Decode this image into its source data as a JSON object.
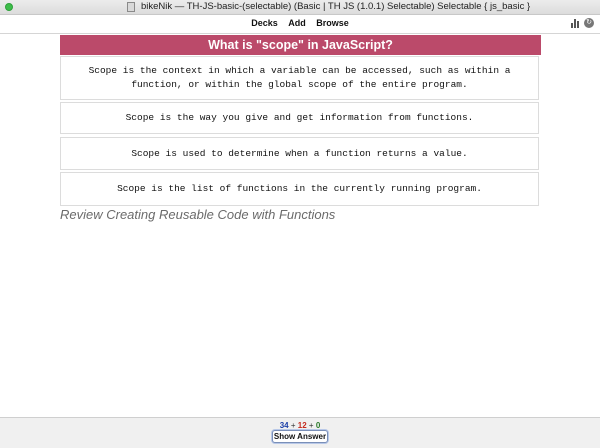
{
  "window": {
    "title": "bikeNik — TH-JS-basic-(selectable) (Basic | TH JS (1.0.1) Selectable) Selectable { js_basic }"
  },
  "toolbar": {
    "decks": "Decks",
    "add": "Add",
    "browse": "Browse",
    "stats_icon": "bar-chart-icon",
    "sync_icon": "sync-icon"
  },
  "card": {
    "question": "What is \"scope\" in JavaScript?",
    "choices": [
      "Scope is the context in which a variable can be accessed, such as within a function, or within the global scope of the entire program.",
      "Scope is the way you give and get information from functions.",
      "Scope is used to determine when a function returns a value.",
      "Scope is the list of functions in the currently running program."
    ],
    "review_link": "Review Creating Reusable Code with Functions"
  },
  "bottom": {
    "count_new": "34",
    "count_learn": "12",
    "count_review": "0",
    "plus": "+",
    "show_answer": "Show Answer"
  },
  "colors": {
    "question_bg": "#bb4a6a",
    "new": "#1a3ea8",
    "learn": "#c42a1e",
    "review": "#2a7a2a"
  }
}
